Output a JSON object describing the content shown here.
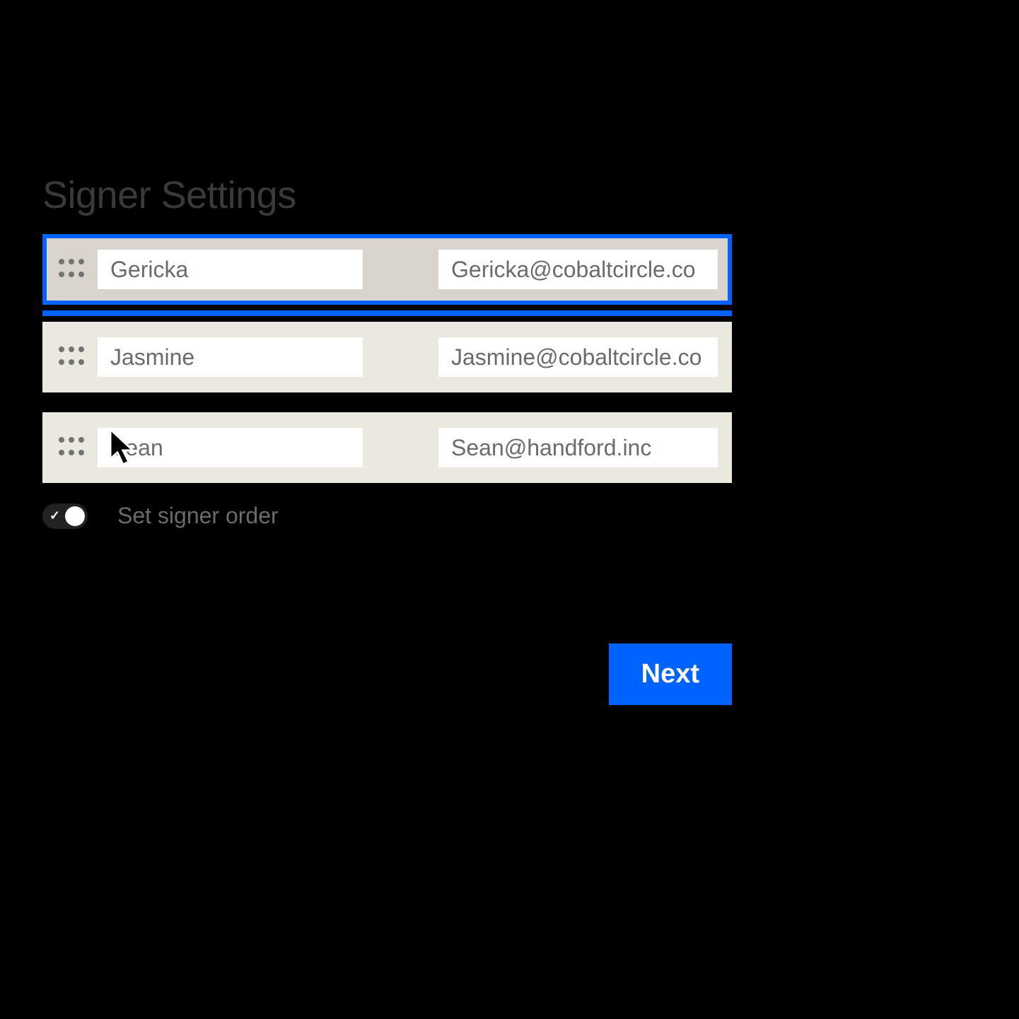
{
  "title": "Signer Settings",
  "signers": [
    {
      "name": "Gericka",
      "email": "Gericka@cobaltcircle.co",
      "active": true
    },
    {
      "name": "Jasmine",
      "email": "Jasmine@cobaltcircle.co",
      "active": false
    },
    {
      "name": "Sean",
      "email": "Sean@handford.inc",
      "active": false
    }
  ],
  "toggle": {
    "label": "Set signer order",
    "enabled": true
  },
  "next_button": "Next",
  "colors": {
    "accent": "#0062ff",
    "row_bg": "#ebe8e0",
    "row_active_bg": "#d9d5cd"
  }
}
